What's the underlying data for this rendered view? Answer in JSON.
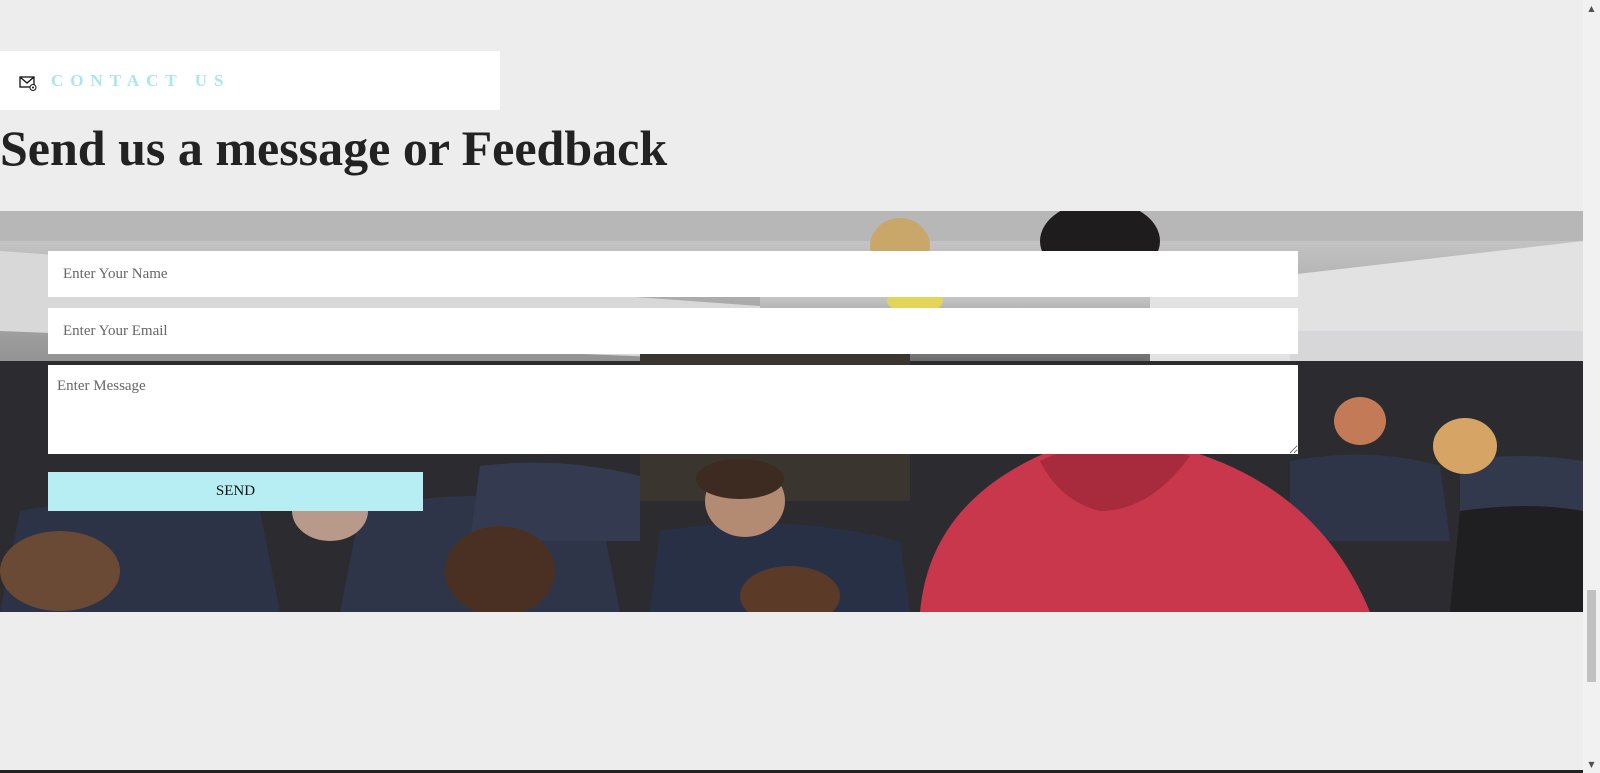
{
  "contact_section": {
    "label": "CONTACT US",
    "icon": "envelope-icon"
  },
  "headline": "Send us a message or Feedback",
  "form": {
    "name_placeholder": "Enter Your Name",
    "email_placeholder": "Enter Your Email",
    "message_placeholder": "Enter Message",
    "send_label": "SEND"
  },
  "colors": {
    "accent": "#b6eef4",
    "label_accent": "#a9e6ef",
    "headline": "#222222",
    "page_background": "#ededed"
  },
  "hero_image": {
    "subject": "airplane-cabin-photo"
  }
}
